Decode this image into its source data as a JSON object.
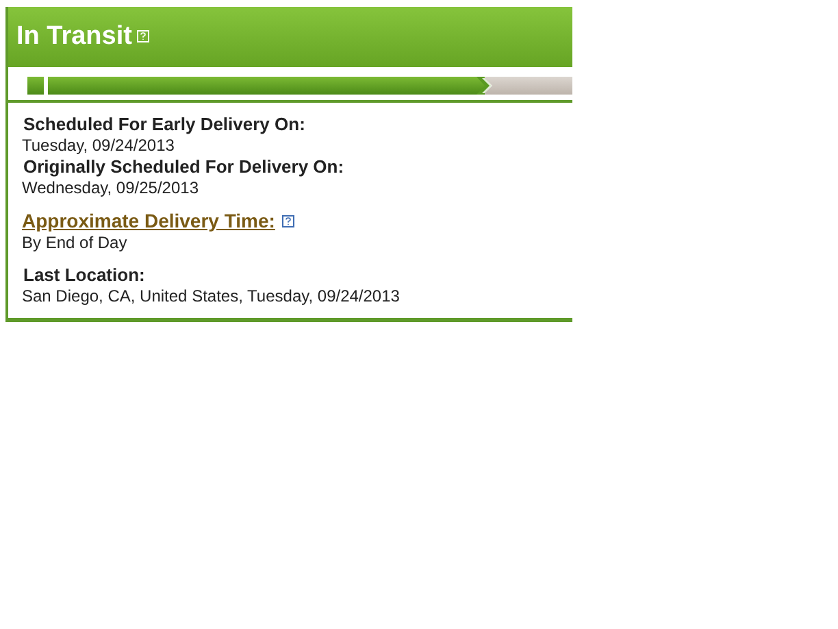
{
  "status": {
    "title": "In Transit"
  },
  "progress": {
    "level": 0.84
  },
  "groups": [
    {
      "entries": [
        {
          "kind": "plain",
          "label": "Scheduled For Early Delivery On:",
          "value": "Tuesday, 09/24/2013"
        },
        {
          "kind": "plain",
          "label": "Originally Scheduled For Delivery On:",
          "value": "Wednesday, 09/25/2013"
        }
      ]
    },
    {
      "entries": [
        {
          "kind": "link",
          "label": "Approximate Delivery Time:",
          "value": "By End of Day"
        }
      ]
    },
    {
      "entries": [
        {
          "kind": "plain",
          "label": "Last Location:",
          "value": "San Diego, CA, United States, Tuesday, 09/24/2013"
        }
      ]
    }
  ]
}
